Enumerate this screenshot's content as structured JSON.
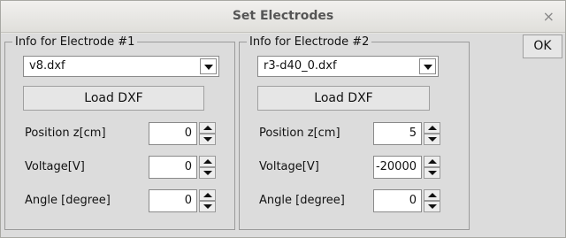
{
  "window": {
    "title": "Set Electrodes",
    "close_glyph": "×"
  },
  "ok_label": "OK",
  "electrodes": [
    {
      "legend": "Info for Electrode #1",
      "file": "v8.dxf",
      "load_label": "Load DXF",
      "position_label": "Position z[cm]",
      "position_value": "0",
      "voltage_label": "Voltage[V]",
      "voltage_value": "0",
      "angle_label": "Angle [degree]",
      "angle_value": "0"
    },
    {
      "legend": "Info for Electrode #2",
      "file": "r3-d40_0.dxf",
      "load_label": "Load DXF",
      "position_label": "Position z[cm]",
      "position_value": "5",
      "voltage_label": "Voltage[V]",
      "voltage_value": "-20000",
      "angle_label": "Angle [degree]",
      "angle_value": "0"
    }
  ]
}
